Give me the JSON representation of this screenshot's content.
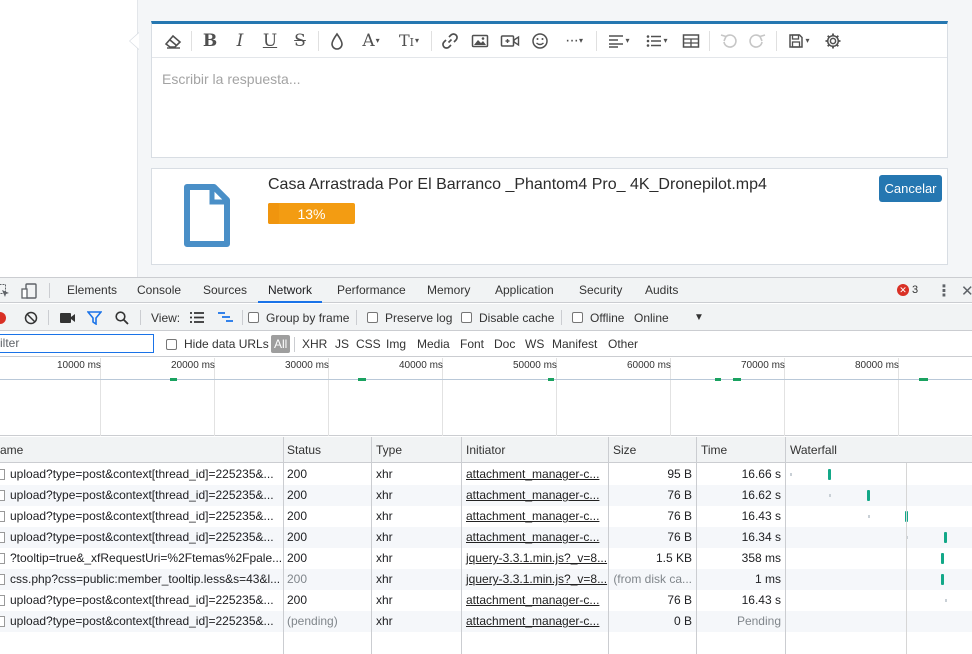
{
  "editor": {
    "placeholder": "Escribir la respuesta...",
    "toolbar_icons": [
      "eraser-icon",
      "bold-icon",
      "italic-icon",
      "underline-icon",
      "strikethrough-icon",
      "text-color-icon",
      "font-size-icon",
      "font-family-icon",
      "link-icon",
      "image-icon",
      "media-icon",
      "smilie-icon",
      "more-icon",
      "align-icon",
      "list-icon",
      "table-icon",
      "undo-icon",
      "redo-icon",
      "drafts-icon",
      "settings-icon"
    ]
  },
  "attachment": {
    "filename": "Casa Arrastrada Por El Barranco _Phantom4 Pro_ 4K_Dronepilot.mp4",
    "progress_text": "13%",
    "progress_value": 0.13,
    "cancel_label": "Cancelar"
  },
  "devtools": {
    "tabs": [
      "Elements",
      "Console",
      "Sources",
      "Network",
      "Performance",
      "Memory",
      "Application",
      "Security",
      "Audits"
    ],
    "active_tab": "Network",
    "error_count": "3",
    "controls": {
      "view_label": "View:",
      "group_by_frame": "Group by frame",
      "preserve_log": "Preserve log",
      "disable_cache": "Disable cache",
      "offline": "Offline",
      "throttle": "Online"
    },
    "filter": {
      "value": "ilter",
      "hide_data_urls": "Hide data URLs",
      "types": [
        "All",
        "XHR",
        "JS",
        "CSS",
        "Img",
        "Media",
        "Font",
        "Doc",
        "WS",
        "Manifest",
        "Other"
      ]
    },
    "overview_ticks": [
      "10000 ms",
      "20000 ms",
      "30000 ms",
      "40000 ms",
      "50000 ms",
      "60000 ms",
      "70000 ms",
      "80000 ms"
    ],
    "columns": [
      "ame",
      "Status",
      "Type",
      "Initiator",
      "Size",
      "Time",
      "Waterfall"
    ],
    "rows": [
      {
        "name": "upload?type=post&context[thread_id]=225235&...",
        "status": "200",
        "type": "xhr",
        "initiator": "attachment_manager-c...",
        "size": "95 B",
        "time": "16.66 s"
      },
      {
        "name": "upload?type=post&context[thread_id]=225235&...",
        "status": "200",
        "type": "xhr",
        "initiator": "attachment_manager-c...",
        "size": "76 B",
        "time": "16.62 s"
      },
      {
        "name": "upload?type=post&context[thread_id]=225235&...",
        "status": "200",
        "type": "xhr",
        "initiator": "attachment_manager-c...",
        "size": "76 B",
        "time": "16.43 s"
      },
      {
        "name": "upload?type=post&context[thread_id]=225235&...",
        "status": "200",
        "type": "xhr",
        "initiator": "attachment_manager-c...",
        "size": "76 B",
        "time": "16.34 s"
      },
      {
        "name": "?tooltip=true&_xfRequestUri=%2Ftemas%2Fpale...",
        "status": "200",
        "type": "xhr",
        "initiator": "jquery-3.3.1.min.js?_v=8...",
        "size": "1.5 KB",
        "time": "358 ms"
      },
      {
        "name": "css.php?css=public:member_tooltip.less&s=43&l...",
        "status": "200",
        "type": "xhr",
        "initiator": "jquery-3.3.1.min.js?_v=8...",
        "size": "(from disk ca...",
        "time": "1 ms"
      },
      {
        "name": "upload?type=post&context[thread_id]=225235&...",
        "status": "200",
        "type": "xhr",
        "initiator": "attachment_manager-c...",
        "size": "76 B",
        "time": "16.43 s"
      },
      {
        "name": "upload?type=post&context[thread_id]=225235&...",
        "status": "(pending)",
        "type": "xhr",
        "initiator": "attachment_manager-c...",
        "size": "0 B",
        "time": "Pending"
      }
    ]
  }
}
